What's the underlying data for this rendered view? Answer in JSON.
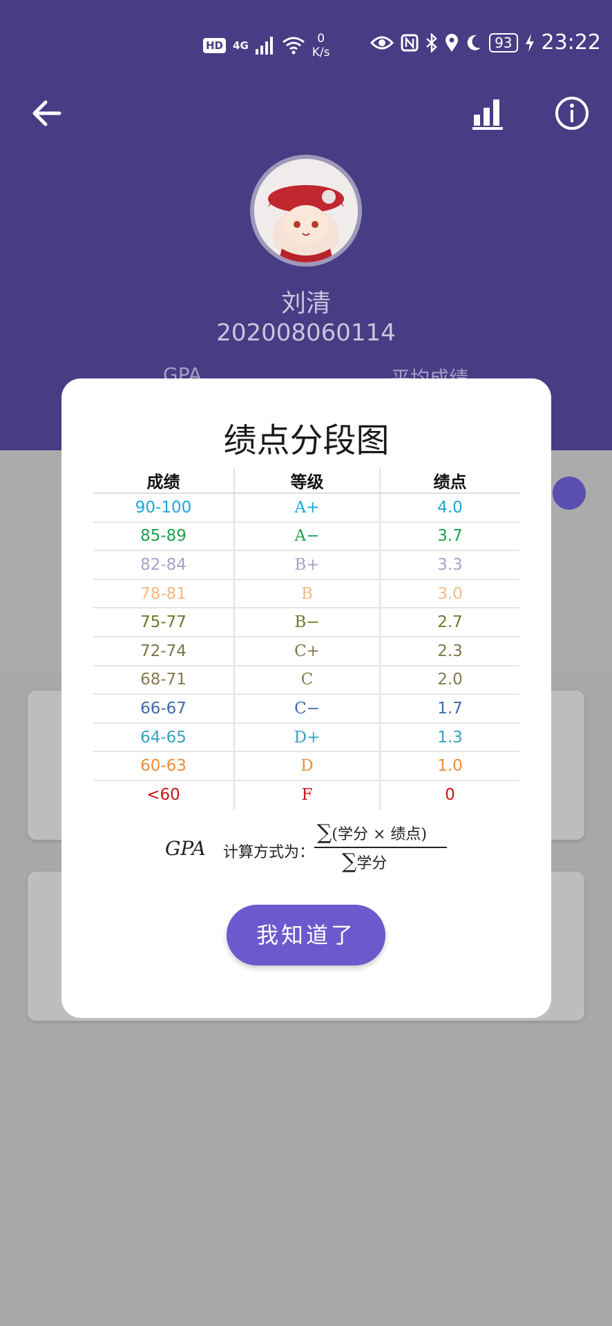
{
  "status_bar": {
    "hd": "HD",
    "signal": "4G",
    "net_speed_value": "0",
    "net_speed_unit": "K/s",
    "battery": "93",
    "time": "23:22"
  },
  "profile": {
    "name": "刘清",
    "student_id": "202008060114",
    "gpa_label": "GPA",
    "avg_label": "平均成绩"
  },
  "modal": {
    "title": "绩点分段图",
    "headers": [
      "成绩",
      "等级",
      "绩点"
    ],
    "rows": [
      {
        "score": "90-100",
        "level": "A+",
        "point": "4.0",
        "color": "#1aa7d9"
      },
      {
        "score": "85-89",
        "level": "A−",
        "point": "3.7",
        "color": "#1f9f4d"
      },
      {
        "score": "82-84",
        "level": "B+",
        "point": "3.3",
        "color": "#a5a2c8"
      },
      {
        "score": "78-81",
        "level": "B",
        "point": "3.0",
        "color": "#f4b987"
      },
      {
        "score": "75-77",
        "level": "B−",
        "point": "2.7",
        "color": "#6b7a2a"
      },
      {
        "score": "72-74",
        "level": "C+",
        "point": "2.3",
        "color": "#7b7448"
      },
      {
        "score": "68-71",
        "level": "C",
        "point": "2.0",
        "color": "#857a4d"
      },
      {
        "score": "66-67",
        "level": "C−",
        "point": "1.7",
        "color": "#3f69a8"
      },
      {
        "score": "64-65",
        "level": "D+",
        "point": "1.3",
        "color": "#36a2bf"
      },
      {
        "score": "60-63",
        "level": "D",
        "point": "1.0",
        "color": "#ec8c3a"
      },
      {
        "score": "<60",
        "level": "F",
        "point": "0",
        "color": "#c41414"
      }
    ],
    "formula": {
      "gpa": "GPA",
      "label": "计算方式为：",
      "numerator": "(学分 × 绩点)",
      "denominator": "学分"
    },
    "confirm_label": "我知道了"
  },
  "icons": {
    "back": "back-arrow-icon",
    "chart": "bar-chart-icon",
    "info": "info-icon"
  },
  "colors": {
    "header": "#463d84",
    "accent": "#6a5acd"
  }
}
